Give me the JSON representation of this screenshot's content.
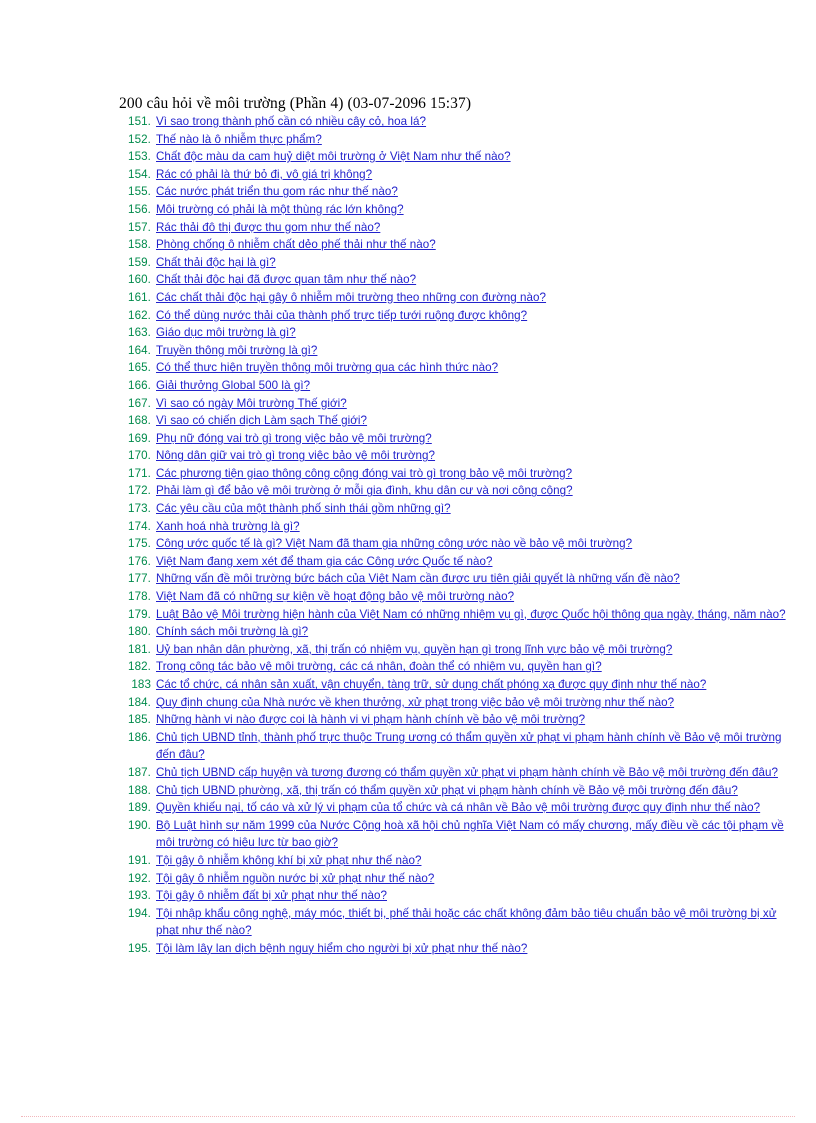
{
  "document": {
    "title": "200 câu hỏi về môi trường (Phần 4) (03-07-2096 15:37)",
    "footer_rule_color": "#f2b6bb",
    "number_color": "#008a4b",
    "link_color": "#2222cc",
    "background_color": "#ffffff"
  },
  "questions": [
    {
      "number": "151.",
      "text": "Vì sao trong thành phố cần có nhiều cây cỏ, hoa lá?"
    },
    {
      "number": "152.",
      "text": "Thế nào là ô nhiễm thực phẩm?"
    },
    {
      "number": "153.",
      "text": "Chất độc màu da cam huỷ diệt môi trường ở Việt Nam như thế nào?"
    },
    {
      "number": "154.",
      "text": "Rác có phải là thứ bỏ đi, vô giá trị không?"
    },
    {
      "number": "155.",
      "text": "Các nước phát triển thu gom rác như thế nào?"
    },
    {
      "number": "156.",
      "text": "Môi trường có phải là một thùng rác lớn không?"
    },
    {
      "number": "157.",
      "text": "Rác thải đô thị được thu gom như thế nào?"
    },
    {
      "number": "158.",
      "text": "Phòng chống ô nhiễm chất dẻo phế thải như thế nào?"
    },
    {
      "number": "159.",
      "text": "Chất thải độc hại là gì?"
    },
    {
      "number": "160.",
      "text": "Chất thải độc hại đã được quan tâm như thế nào?"
    },
    {
      "number": "161.",
      "text": "Các chất thải độc hại gây ô nhiễm môi trường theo những con đường nào?"
    },
    {
      "number": "162.",
      "text": "Có thể dùng nước thải của thành phố trực tiếp tưới ruộng được không?"
    },
    {
      "number": "163.",
      "text": "Giáo dục môi trường là gì?"
    },
    {
      "number": "164.",
      "text": "Truyền thông môi trường là gì?"
    },
    {
      "number": "165.",
      "text": "Có thể thực hiện truyền thông môi trường qua các hình thức nào?"
    },
    {
      "number": "166.",
      "text": "Giải thưởng Global 500 là gì?"
    },
    {
      "number": "167.",
      "text": "Vì sao có ngày Môi trường Thế giới?"
    },
    {
      "number": "168.",
      "text": "Vì sao có chiến dịch Làm sạch Thế giới?"
    },
    {
      "number": "169.",
      "text": "Phụ nữ đóng vai trò gì trong việc bảo vệ môi trường?"
    },
    {
      "number": "170.",
      "text": "Nông dân giữ vai trò gì trong việc bảo vệ môi trường?"
    },
    {
      "number": "171.",
      "text": "Các phương tiện giao thông công cộng đóng vai trò gì trong bảo vệ môi trường?"
    },
    {
      "number": "172.",
      "text": "Phải làm gì để bảo vệ môi trường ở mỗi gia đình, khu dân cư và nơi công cộng?"
    },
    {
      "number": "173.",
      "text": "Các yêu cầu của một thành phố sinh thái gồm những gì?"
    },
    {
      "number": "174.",
      "text": "Xanh hoá nhà trường là gì?"
    },
    {
      "number": "175.",
      "text": "Công ước quốc tế là gì? Việt Nam đã tham gia những công ước nào về bảo vệ môi trường?"
    },
    {
      "number": "176.",
      "text": "Việt Nam đang xem xét để tham gia các Công ước Quốc tế nào?"
    },
    {
      "number": "177.",
      "text": "Những vấn đề môi trường bức bách của Việt Nam cần được ưu tiên giải quyết là những vấn đề nào?"
    },
    {
      "number": "178.",
      "text": "Việt Nam đã có những sự kiện về hoạt động bảo vệ môi trường nào?"
    },
    {
      "number": "179.",
      "text": "Luật Bảo vệ Môi trường hiện hành của Việt Nam có những nhiệm vụ gì, được Quốc hội thông qua ngày, tháng, năm nào?"
    },
    {
      "number": "180.",
      "text": "Chính sách môi trường là gì?"
    },
    {
      "number": "181.",
      "text": "Uỷ ban nhân dân phường, xã, thị trấn có nhiệm vụ, quyền hạn gì trong lĩnh vực bảo vệ môi trường?"
    },
    {
      "number": "182.",
      "text": "Trong công tác bảo vệ môi trường, các cá nhân, đoàn thể có nhiệm vụ, quyền hạn gì?"
    },
    {
      "number": "183",
      "text": "Các tổ chức, cá nhân sản xuất, vận chuyển, tàng trữ, sử dụng chất phóng xạ được quy định như thế nào?"
    },
    {
      "number": "184.",
      "text": "Quy định chung của Nhà nước về khen thưởng, xử phạt trong việc bảo vệ môi trường như thế nào?"
    },
    {
      "number": "185.",
      "text": "Những hành vi nào được coi là hành vi vi phạm hành chính về bảo vệ môi trường?"
    },
    {
      "number": "186.",
      "text": "Chủ tịch UBND tỉnh, thành phố trực thuộc Trung ương có thẩm quyền xử phạt vi phạm hành chính về Bảo vệ môi trường đến đâu?"
    },
    {
      "number": "187.",
      "text": "Chủ tịch UBND cấp huyện và tương đương có thẩm quyền xử phạt vi phạm hành chính về Bảo vệ môi trường đến đâu?"
    },
    {
      "number": "188.",
      "text": "Chủ tịch UBND phường, xã, thị trấn có thẩm quyền xử phạt vi phạm hành chính về Bảo vệ môi trường đến đâu?"
    },
    {
      "number": "189.",
      "text": "Quyền khiếu nại, tố cáo và xử lý vi phạm của tổ chức và cá nhân về Bảo vệ môi trường được quy định như thế nào?"
    },
    {
      "number": "190.",
      "text": "Bộ Luật hình sự năm 1999 của Nước Cộng hoà xã hội chủ nghĩa Việt Nam có mấy chương, mấy điều về các tội phạm về môi trường có hiệu lực từ bao giờ?"
    },
    {
      "number": "191.",
      "text": "Tội gây ô nhiễm không khí bị xử phạt như thế nào?"
    },
    {
      "number": "192.",
      "text": "Tội gây ô nhiễm nguồn nước bị xử phạt như thế nào?"
    },
    {
      "number": "193.",
      "text": "Tội gây ô nhiễm đất bị xử phạt như thế nào?"
    },
    {
      "number": "194.",
      "text": "Tội nhập khẩu công nghệ, máy móc, thiết bị, phế thải hoặc các chất không đảm bảo tiêu chuẩn bảo vệ môi trường bị xử phạt như thế nào?"
    },
    {
      "number": "195.",
      "text": "Tội làm lây lan dịch bệnh nguy hiểm cho người bị xử phạt như thế nào?"
    }
  ]
}
